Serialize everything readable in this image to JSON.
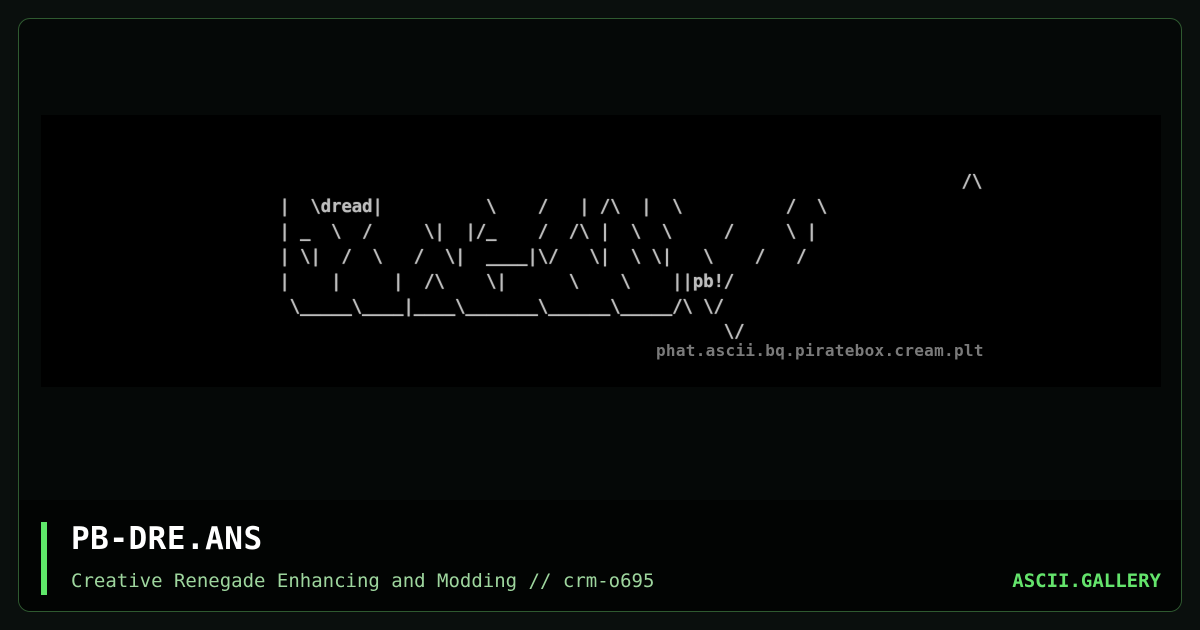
{
  "artwork": {
    "ascii_lines": [
      "                                                                   /\\",
      " |  \\dread|          \\    /   | /\\  |  \\          /  \\",
      " | _  \\  /     \\|  |/_    /  /\\ |  \\  \\     /     \\ |",
      " | \\|  /  \\   /  \\|  ____|\\/   \\|  \\ \\|   \\    /   /",
      " |    |     |  /\\    \\|      \\    \\    ||pb!/",
      "  \\_____\\____|____\\_______\\______\\_____/\\ \\/",
      "                                            \\/"
    ],
    "signature": "phat.ascii.bq.piratebox.cream.plt"
  },
  "footer": {
    "title": "PB-DRE.ANS",
    "subtitle": "Creative Renegade Enhancing and Modding // crm-o695",
    "brand": "ASCII.GALLERY"
  },
  "colors": {
    "accent": "#5fe86a",
    "frame_border": "#2f5a30",
    "subtitle": "#9ed69e"
  }
}
